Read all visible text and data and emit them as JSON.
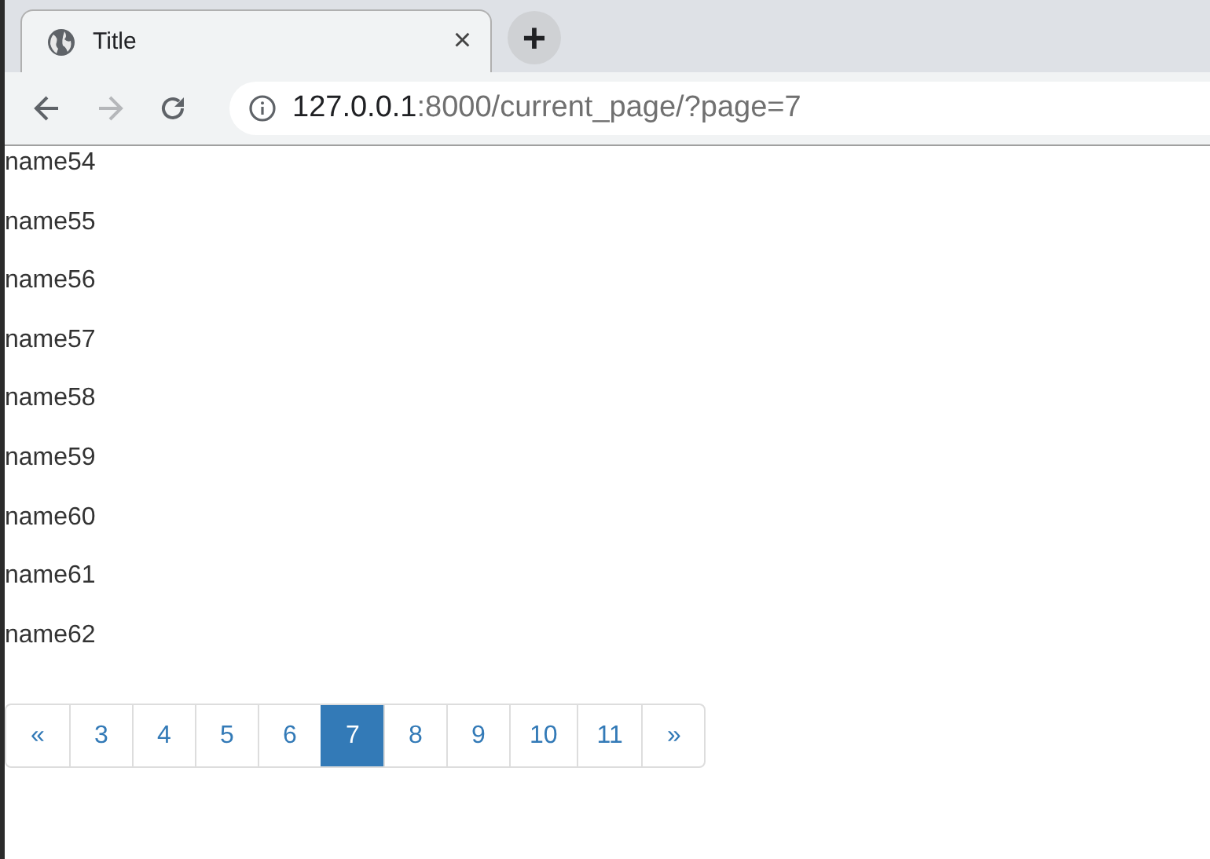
{
  "tab": {
    "title": "Title",
    "close": "×"
  },
  "new_tab": "+",
  "toolbar": {
    "forward_disabled": true
  },
  "address": {
    "host": "127.0.0.1",
    "rest": ":8000/current_page/?page=7"
  },
  "items": [
    "name54",
    "name55",
    "name56",
    "name57",
    "name58",
    "name59",
    "name60",
    "name61",
    "name62"
  ],
  "pagination": [
    {
      "label": "«",
      "selected": false
    },
    {
      "label": "3",
      "selected": false
    },
    {
      "label": "4",
      "selected": false
    },
    {
      "label": "5",
      "selected": false
    },
    {
      "label": "6",
      "selected": false
    },
    {
      "label": "7",
      "selected": true
    },
    {
      "label": "8",
      "selected": false
    },
    {
      "label": "9",
      "selected": false
    },
    {
      "label": "10",
      "selected": false
    },
    {
      "label": "11",
      "selected": false
    },
    {
      "label": "»",
      "selected": false
    }
  ]
}
